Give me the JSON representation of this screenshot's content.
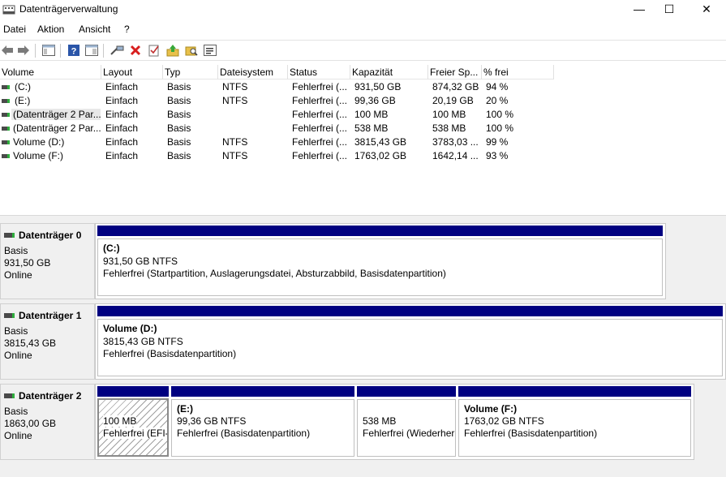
{
  "window": {
    "title": "Datenträgerverwaltung",
    "min_glyph": "—",
    "max_glyph": "☐",
    "close_glyph": "✕"
  },
  "menu": {
    "items": [
      "Datei",
      "Aktion",
      "Ansicht",
      "?"
    ]
  },
  "toolbar": {
    "icons": [
      "back-arrow-icon",
      "forward-arrow-icon",
      "console-tree-icon",
      "help-icon",
      "properties-view-icon",
      "connect-disk-icon",
      "delete-icon",
      "check-properties-icon",
      "import-up-icon",
      "search-folder-icon",
      "task-pane-icon"
    ]
  },
  "table": {
    "headers": [
      "Volume",
      "Layout",
      "Typ",
      "Dateisystem",
      "Status",
      "Kapazität",
      "Freier Sp...",
      "% frei"
    ],
    "rows": [
      [
        "(C:)",
        "Einfach",
        "Basis",
        "NTFS",
        "Fehlerfrei (...",
        "931,50 GB",
        "874,32 GB",
        "94 %"
      ],
      [
        "(E:)",
        "Einfach",
        "Basis",
        "NTFS",
        "Fehlerfrei (...",
        "99,36 GB",
        "20,19 GB",
        "20 %"
      ],
      [
        "(Datenträger 2 Par...",
        "Einfach",
        "Basis",
        "",
        "Fehlerfrei (...",
        "100 MB",
        "100 MB",
        "100 %"
      ],
      [
        "(Datenträger 2 Par...",
        "Einfach",
        "Basis",
        "",
        "Fehlerfrei (...",
        "538 MB",
        "538 MB",
        "100 %"
      ],
      [
        "Volume (D:)",
        "Einfach",
        "Basis",
        "NTFS",
        "Fehlerfrei (...",
        "3815,43 GB",
        "3783,03 ...",
        "99 %"
      ],
      [
        "Volume (F:)",
        "Einfach",
        "Basis",
        "NTFS",
        "Fehlerfrei (...",
        "1763,02 GB",
        "1642,14 ...",
        "93 %"
      ]
    ]
  },
  "disks": [
    {
      "name": "Datenträger 0",
      "type": "Basis",
      "size": "931,50 GB",
      "state": "Online",
      "partitions": [
        {
          "title": "(C:)",
          "line1": "931,50 GB NTFS",
          "line2": "Fehlerfrei (Startpartition, Auslagerungsdatei, Absturzabbild, Basisdatenpartition)"
        }
      ]
    },
    {
      "name": "Datenträger 1",
      "type": "Basis",
      "size": "3815,43 GB",
      "state": "Online",
      "partitions": [
        {
          "title": "Volume  (D:)",
          "line1": "3815,43 GB NTFS",
          "line2": "Fehlerfrei (Basisdatenpartition)"
        }
      ]
    },
    {
      "name": "Datenträger 2",
      "type": "Basis",
      "size": "1863,00 GB",
      "state": "Online",
      "partitions": [
        {
          "title": "",
          "line1": "100 MB",
          "line2": "Fehlerfrei (EFI-"
        },
        {
          "title": "(E:)",
          "line1": "99,36 GB NTFS",
          "line2": "Fehlerfrei (Basisdatenpartition)"
        },
        {
          "title": "",
          "line1": "538 MB",
          "line2": "Fehlerfrei (Wiederher"
        },
        {
          "title": "Volume  (F:)",
          "line1": "1763,02 GB NTFS",
          "line2": "Fehlerfrei (Basisdatenpartition)"
        }
      ]
    }
  ],
  "colors": {
    "partition_bar": "#000080",
    "disk_bg": "#f0f0f0",
    "delete_red": "#d81e1e"
  }
}
